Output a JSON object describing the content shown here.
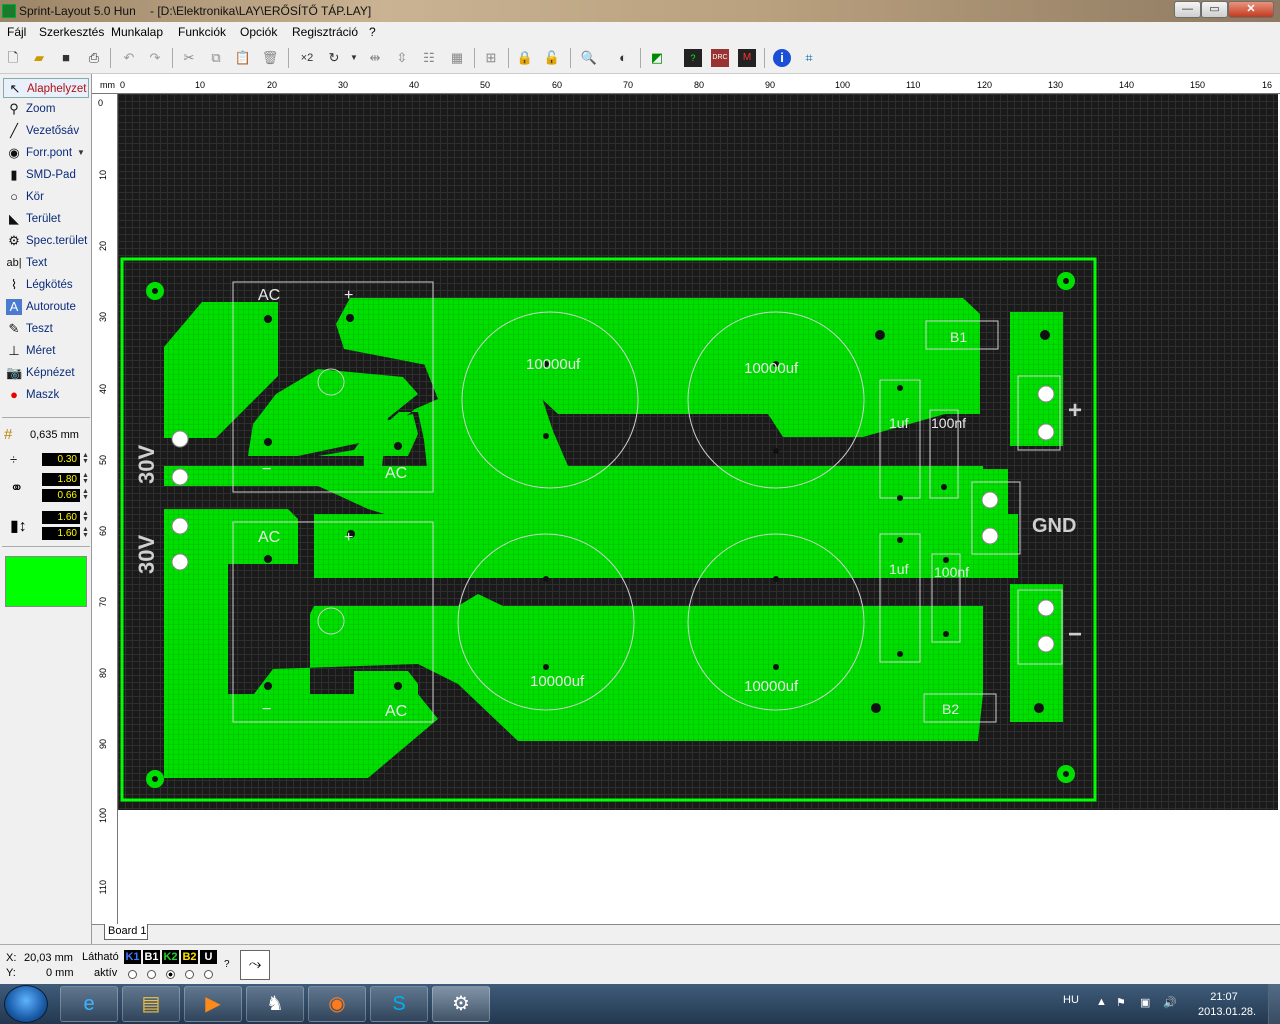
{
  "window": {
    "app_title": "Sprint-Layout 5.0 Hun",
    "path": "- [D:\\Elektronika\\LAY\\ERŐSÍTŐ TÁP.LAY]",
    "minimize": "—",
    "restore": "▭",
    "close": "✕"
  },
  "menu": [
    "Fájl",
    "Szerkesztés",
    "Munkalap",
    "Funkciók",
    "Opciók",
    "Regisztráció",
    "?"
  ],
  "tools": [
    {
      "label": "Alaphelyzet",
      "icon": "arrow-cursor-icon"
    },
    {
      "label": "Zoom",
      "icon": "magnifier-icon"
    },
    {
      "label": "Vezetősáv",
      "icon": "track-icon"
    },
    {
      "label": "Forr.pont",
      "icon": "pad-icon"
    },
    {
      "label": "SMD-Pad",
      "icon": "smd-pad-icon"
    },
    {
      "label": "Kör",
      "icon": "circle-icon"
    },
    {
      "label": "Terület",
      "icon": "area-icon"
    },
    {
      "label": "Spec.terület",
      "icon": "special-area-icon"
    },
    {
      "label": "Text",
      "icon": "text-icon"
    },
    {
      "label": "Légkötés",
      "icon": "airwire-icon"
    },
    {
      "label": "Autoroute",
      "icon": "autoroute-icon"
    },
    {
      "label": "Teszt",
      "icon": "test-icon"
    },
    {
      "label": "Méret",
      "icon": "measure-icon"
    },
    {
      "label": "Képnézet",
      "icon": "camera-icon"
    },
    {
      "label": "Maszk",
      "icon": "mask-icon"
    }
  ],
  "grid": "0,635 mm",
  "values": {
    "track_width": "0.30",
    "pad_outer": "1.80",
    "pad_inner": "0.66",
    "smd_w": "1.60",
    "smd_h": "1.60"
  },
  "active_color": "#00ff00",
  "ruler_top": [
    "mm",
    "0",
    "10",
    "20",
    "30",
    "40",
    "50",
    "60",
    "70",
    "80",
    "90",
    "100",
    "110",
    "120",
    "130",
    "140",
    "150",
    "16"
  ],
  "ruler_left": [
    "0",
    "10",
    "20",
    "30",
    "40",
    "50",
    "60",
    "70",
    "80",
    "90",
    "100",
    "110"
  ],
  "pcb": {
    "labels": {
      "ac1": "AC",
      "ac2": "AC",
      "ac3": "AC",
      "ac4": "AC",
      "plus1": "+",
      "plus2": "+",
      "minus1": "−",
      "minus2": "−",
      "v30a": "30V",
      "v30b": "30V",
      "gnd": "GND",
      "out_plus": "+",
      "out_minus": "−",
      "cap1": "10000uf",
      "cap2": "10000uf",
      "cap3": "10000uf",
      "cap4": "10000uf",
      "c1uf_a": "1uf",
      "c100_a": "100nf",
      "c1uf_b": "1uf",
      "c100_b": "100nf",
      "b1": "B1",
      "b2": "B2"
    }
  },
  "board_tab": "Board 1",
  "status": {
    "x_label": "X:",
    "x_val": "20,03 mm",
    "y_label": "Y:",
    "y_val": "0 mm",
    "visible": "Látható",
    "active": "aktív",
    "q": "?",
    "layers": [
      {
        "name": "K1",
        "color": "#3a7bff"
      },
      {
        "name": "B1",
        "color": "#ffffff"
      },
      {
        "name": "K2",
        "color": "#25d025"
      },
      {
        "name": "B2",
        "color": "#ffe000"
      },
      {
        "name": "U",
        "color": "#ffffff"
      }
    ]
  },
  "taskbar": {
    "lang": "HU",
    "time": "21:07",
    "date": "2013.01.28."
  }
}
